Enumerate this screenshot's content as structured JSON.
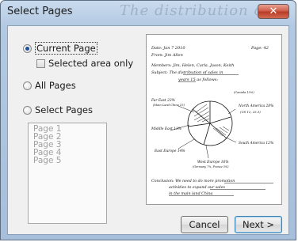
{
  "window": {
    "title": "Select Pages",
    "background_scribble": "The distribution of",
    "close_symbol": "✕"
  },
  "options": {
    "current_page_label": "Current Page",
    "selected_area_label": "Selected area only",
    "all_pages_label": "All Pages",
    "select_pages_label": "Select Pages",
    "selected_option": "current_page"
  },
  "page_list": [
    "Page 1",
    "Page 2",
    "Page 3",
    "Page 4",
    "Page 5"
  ],
  "preview": {
    "date_line": "Date: Jan 7 2010",
    "page_line": "Page: 42",
    "from_line": "From: Jim Allen",
    "members_line": "Members: Jim, Helen, Carla, Jason, Keith",
    "subject_line": "Subject: The distribution of sales in",
    "subject_line2": "years 15 as follows:",
    "note_top_right": "(Canada 15%)",
    "label_far_east": "Far East 23%",
    "label_far_east_sub": "(Main Land China 15)",
    "label_north_america": "North America 28%",
    "label_north_america_sub": "(US 12, 25.3)",
    "label_middle_east": "Middle East 13%",
    "label_east_europe": "East Europe 14%",
    "label_south_america": "South America 12%",
    "label_west_europe": "West Europe 16%",
    "label_west_europe_sub": "(Germany 7%, France 5%)",
    "conclusion_line1": "Conclusion: We need to do more promotion",
    "conclusion_line2": "activities to expand our sales",
    "conclusion_line3": "in the main land China"
  },
  "buttons": {
    "cancel": "Cancel",
    "next": "Next >"
  }
}
